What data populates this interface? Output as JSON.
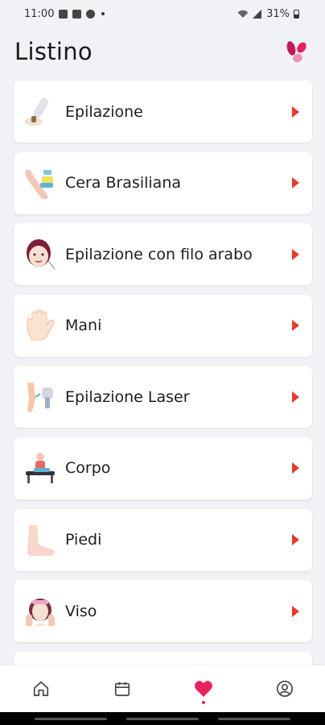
{
  "status": {
    "time": "11:00",
    "battery": "31%"
  },
  "header": {
    "title": "Listino"
  },
  "items": [
    {
      "label": "Epilazione",
      "icon": "wax-spatula-icon"
    },
    {
      "label": "Cera Brasiliana",
      "icon": "wax-leg-icon"
    },
    {
      "label": "Epilazione con filo arabo",
      "icon": "threading-face-icon"
    },
    {
      "label": "Mani",
      "icon": "hand-icon"
    },
    {
      "label": "Epilazione Laser",
      "icon": "laser-leg-icon"
    },
    {
      "label": "Corpo",
      "icon": "massage-icon"
    },
    {
      "label": "Piedi",
      "icon": "foot-icon"
    },
    {
      "label": "Viso",
      "icon": "face-care-icon"
    }
  ],
  "nav": [
    {
      "name": "home-icon",
      "active": false
    },
    {
      "name": "calendar-icon",
      "active": false
    },
    {
      "name": "heart-icon",
      "active": true
    },
    {
      "name": "profile-icon",
      "active": false
    }
  ],
  "colors": {
    "accent": "#e8245c",
    "chevron": "#e63b2e",
    "background": "#f1f2f6"
  }
}
